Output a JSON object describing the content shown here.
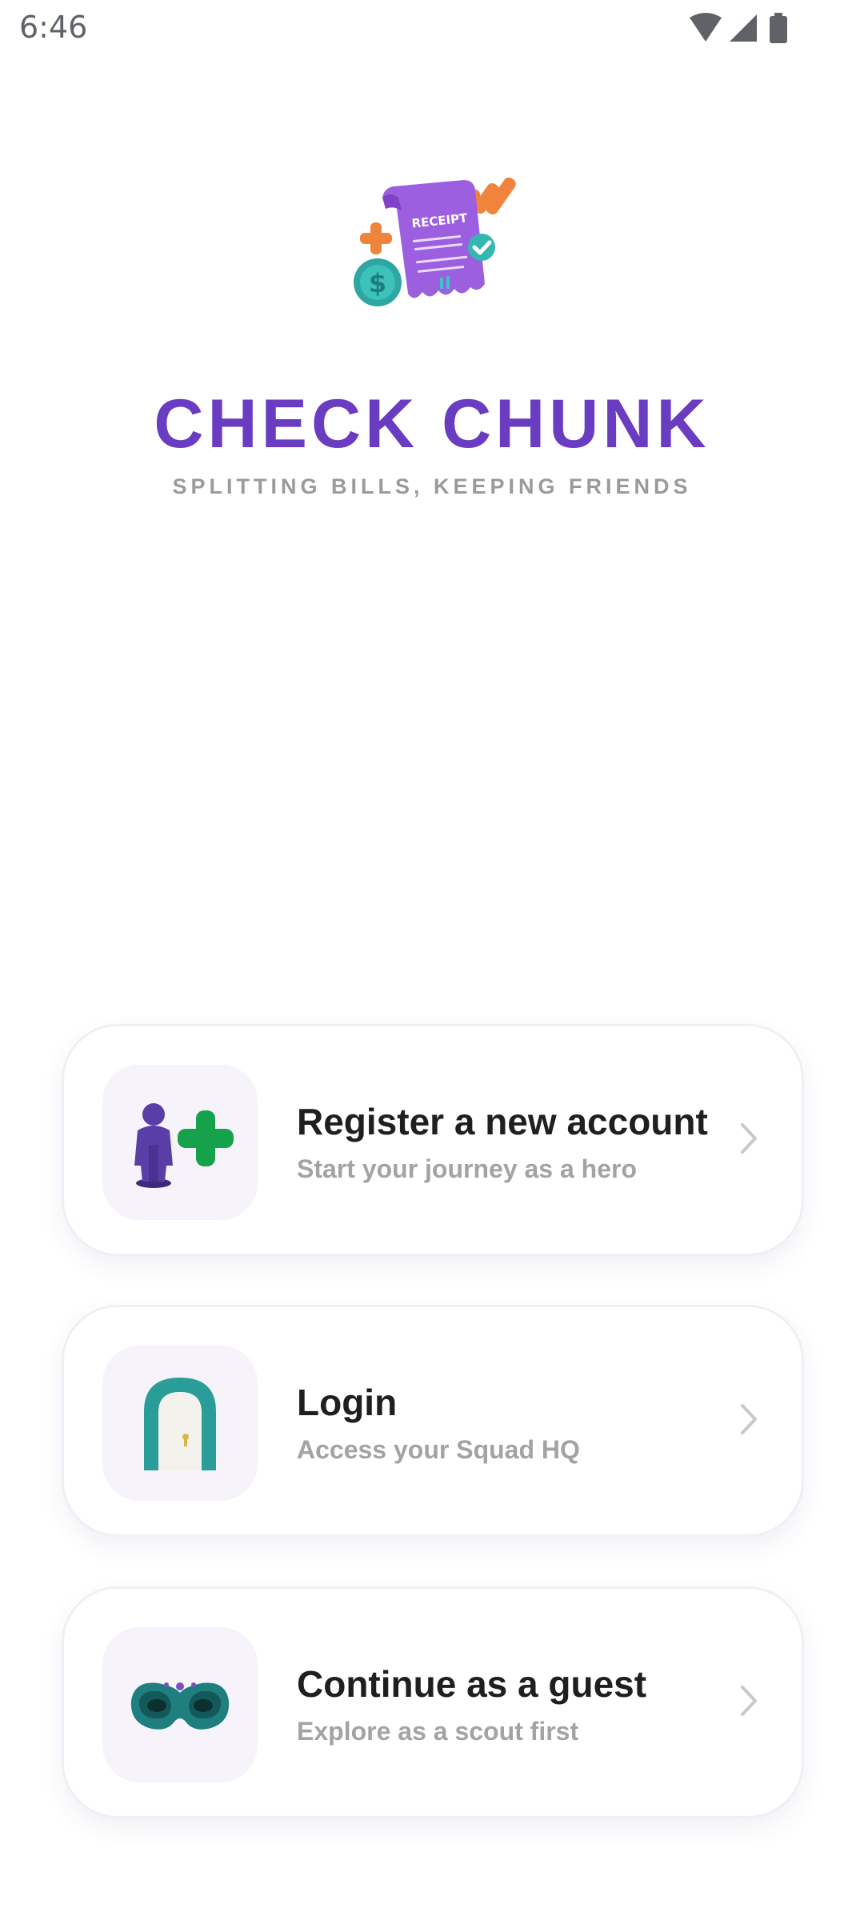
{
  "status_bar": {
    "time": "6:46",
    "icons": [
      "wifi-icon",
      "signal-icon",
      "battery-icon"
    ]
  },
  "hero": {
    "illustration": "receipt-illustration",
    "receipt_label": "RECEIPT",
    "title": "CHECK CHUNK",
    "tagline": "SPLITTING BILLS, KEEPING FRIENDS"
  },
  "options": [
    {
      "icon": "person-plus-icon",
      "title": "Register a new account",
      "subtitle": "Start your journey as a hero"
    },
    {
      "icon": "door-icon",
      "title": "Login",
      "subtitle": "Access your Squad HQ"
    },
    {
      "icon": "mask-icon",
      "title": "Continue as a guest",
      "subtitle": "Explore as a scout first"
    }
  ],
  "colors": {
    "brand_purple": "#6a3cc2",
    "tagline_gray": "#9a9a9a",
    "card_title": "#1f1f1f",
    "card_subtitle": "#a3a3a3",
    "icon_tile_bg": "#f6f3fb"
  }
}
